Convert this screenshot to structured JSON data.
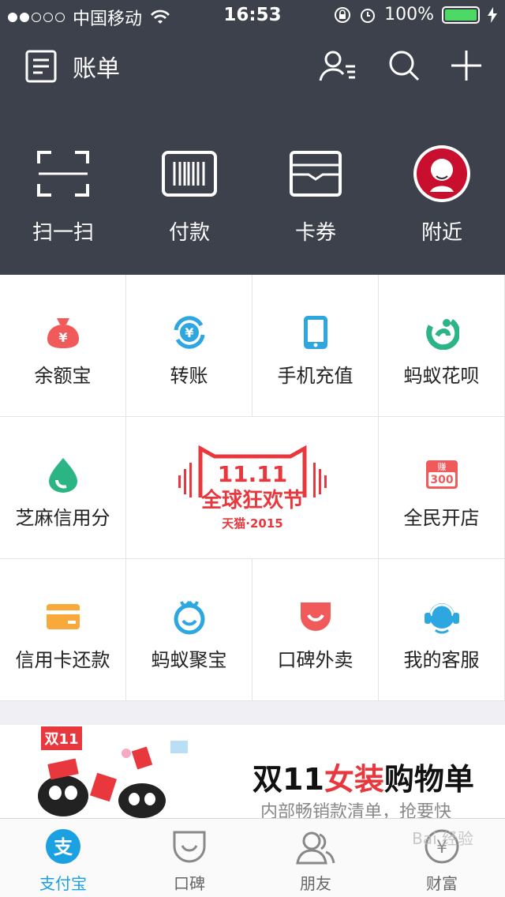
{
  "status": {
    "carrier": "中国移动",
    "time": "16:53",
    "battery": "100%"
  },
  "navbar": {
    "title": "账单"
  },
  "quick": [
    {
      "label": "扫一扫",
      "icon": "scan-icon"
    },
    {
      "label": "付款",
      "icon": "barcode-icon"
    },
    {
      "label": "卡券",
      "icon": "wallet-icon"
    },
    {
      "label": "附近",
      "icon": "kfc-logo-icon"
    }
  ],
  "grid": [
    {
      "label": "余额宝",
      "icon": "money-bag-icon",
      "color": "#f05a5a"
    },
    {
      "label": "转账",
      "icon": "transfer-icon",
      "color": "#2ea7e0"
    },
    {
      "label": "手机充值",
      "icon": "phone-icon",
      "color": "#2ea7e0"
    },
    {
      "label": "蚂蚁花呗",
      "icon": "huabei-icon",
      "color": "#2bb585"
    },
    {
      "label": "芝麻信用分",
      "icon": "sesame-icon",
      "color": "#2bb585"
    },
    {
      "label": "全民开店",
      "icon": "shop-icon",
      "color": "#f05a5a"
    },
    {
      "label": "信用卡还款",
      "icon": "card-icon",
      "color": "#f7a93b"
    },
    {
      "label": "蚂蚁聚宝",
      "icon": "jubao-icon",
      "color": "#2ea7e0"
    },
    {
      "label": "口碑外卖",
      "icon": "takeout-icon",
      "color": "#f05a5a"
    },
    {
      "label": "我的客服",
      "icon": "service-icon",
      "color": "#2ea7e0"
    }
  ],
  "promo": {
    "top": "11.11",
    "main": "全球狂欢节",
    "sub": "天猫·2015",
    "shop_badge_top": "赚",
    "shop_badge_num": "300"
  },
  "banner": {
    "title_a": "双11",
    "title_b": "女装",
    "title_c": "购物单",
    "subtitle": "内部畅销款清单，抢要快",
    "tag": "双11"
  },
  "tabs": [
    {
      "label": "支付宝",
      "icon": "alipay-icon",
      "active": true
    },
    {
      "label": "口碑",
      "icon": "koubei-icon"
    },
    {
      "label": "朋友",
      "icon": "friends-icon"
    },
    {
      "label": "财富",
      "icon": "wealth-icon"
    }
  ],
  "watermark": "Bai 经验"
}
